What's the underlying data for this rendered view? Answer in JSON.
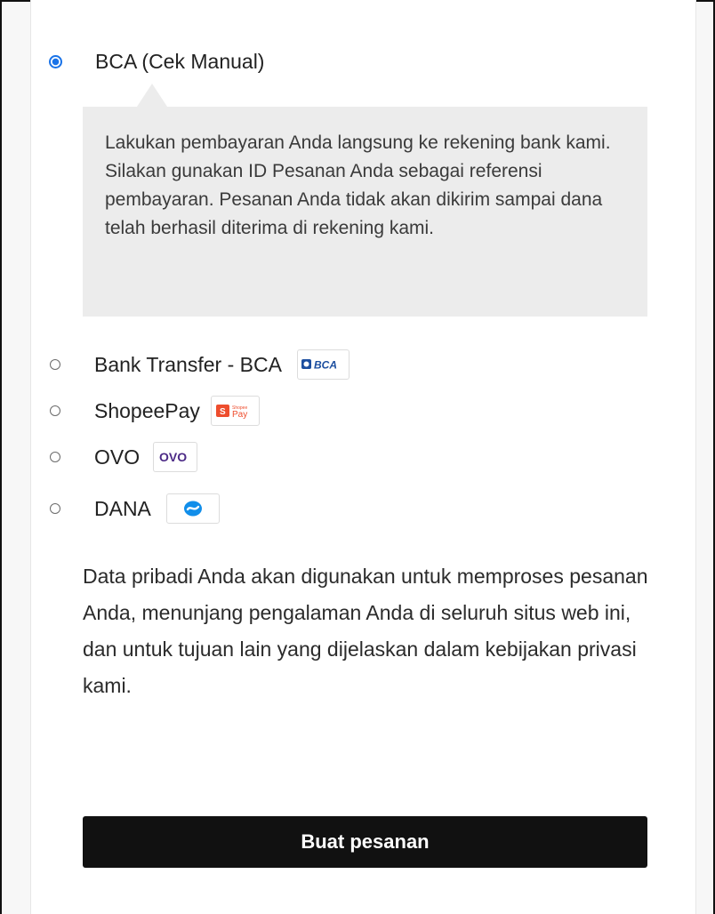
{
  "payment": {
    "selected": {
      "label": "BCA (Cek Manual)",
      "description": "Lakukan pembayaran Anda langsung ke rekening bank kami. Silakan gunakan ID Pesanan Anda sebagai referensi pembayaran. Pesanan Anda tidak akan dikirim sampai dana telah berhasil diterima di rekening kami."
    },
    "methods": [
      {
        "label": "Bank Transfer - BCA",
        "logo": "bca-logo",
        "logo_text": "BCA"
      },
      {
        "label": "ShopeePay",
        "logo": "shopeepay-logo",
        "logo_text": "Pay"
      },
      {
        "label": "OVO",
        "logo": "ovo-logo",
        "logo_text": "OVO"
      },
      {
        "label": "DANA",
        "logo": "dana-logo",
        "logo_text": ""
      }
    ]
  },
  "privacy_notice": "Data pribadi Anda akan digunakan untuk memproses pesanan Anda, menunjang pengalaman Anda di seluruh situs web ini, dan untuk tujuan lain yang dijelaskan dalam kebijakan privasi kami.",
  "order_button_label": "Buat pesanan",
  "colors": {
    "radio_selected": "#1a73e8",
    "button_bg": "#111111",
    "ovo_purple": "#4c2a86",
    "shopee_orange": "#ee4d2d",
    "dana_blue": "#118eea",
    "bca_blue": "#1d4fa0"
  }
}
